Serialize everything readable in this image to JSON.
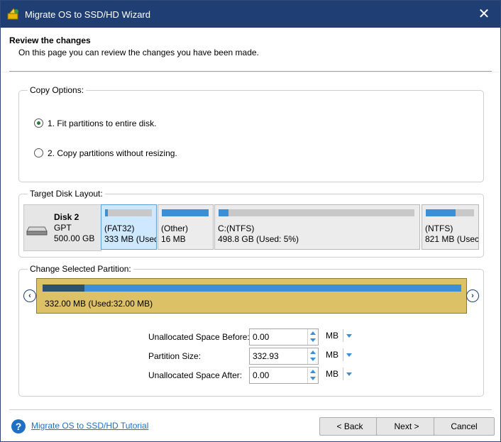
{
  "window": {
    "title": "Migrate OS to SSD/HD Wizard",
    "close_glyph": "✕"
  },
  "header": {
    "title": "Review the changes",
    "subtitle": "On this page you can review the changes you have been made."
  },
  "copy_options": {
    "legend": "Copy Options:",
    "options": [
      {
        "label": "1. Fit partitions to entire disk.",
        "selected": true
      },
      {
        "label": "2. Copy partitions without resizing.",
        "selected": false
      }
    ]
  },
  "target_layout": {
    "legend": "Target Disk Layout:",
    "disk": {
      "name": "Disk 2",
      "type": "GPT",
      "size": "500.00 GB"
    },
    "partitions": [
      {
        "line1": "(FAT32)",
        "line2": "333 MB (Used:",
        "usage": 0.06,
        "selected": true
      },
      {
        "line1": "(Other)",
        "line2": "16 MB",
        "usage": 1.0,
        "selected": false
      },
      {
        "line1": "C:(NTFS)",
        "line2": "498.8 GB (Used: 5%)",
        "usage": 0.05,
        "selected": false
      },
      {
        "line1": "(NTFS)",
        "line2": "821 MB (Usec",
        "usage": 0.62,
        "selected": false
      }
    ]
  },
  "change_partition": {
    "legend": "Change Selected Partition:",
    "bar_label": "332.00 MB (Used:32.00 MB)",
    "used_fraction": 0.1,
    "fields": [
      {
        "label": "Unallocated Space Before:",
        "value": "0.00",
        "unit": "MB"
      },
      {
        "label": "Partition Size:",
        "value": "332.93",
        "unit": "MB"
      },
      {
        "label": "Unallocated Space After:",
        "value": "0.00",
        "unit": "MB"
      }
    ]
  },
  "footer": {
    "help_glyph": "?",
    "tutorial_link": "Migrate OS to SSD/HD Tutorial",
    "back_label": "< Back",
    "next_label": "Next >",
    "cancel_label": "Cancel"
  },
  "colors": {
    "titlebar": "#1f3e73",
    "accent": "#3a8fd6",
    "partition_fill": "#dcc166"
  }
}
